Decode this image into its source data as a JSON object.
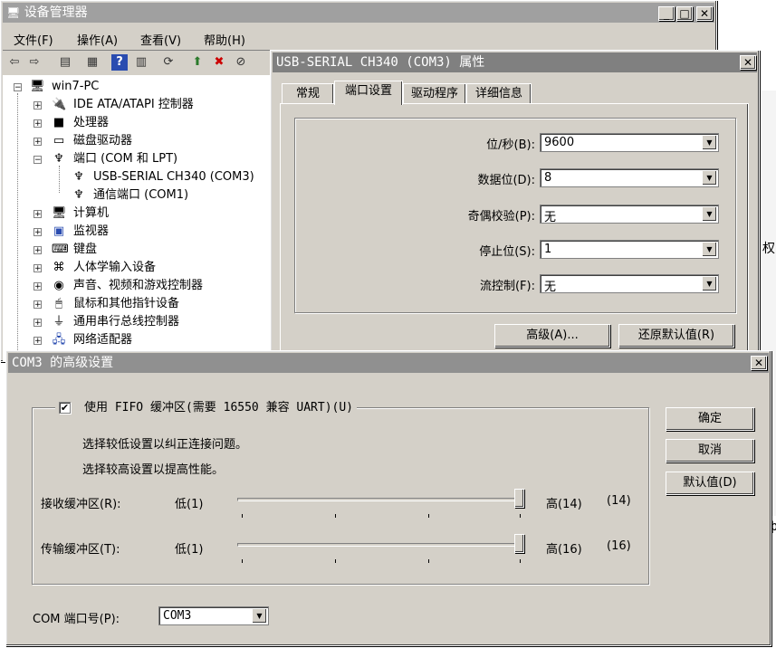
{
  "devmgr": {
    "title": "设备管理器",
    "menu": [
      "文件(F)",
      "操作(A)",
      "查看(V)",
      "帮助(H)"
    ],
    "root": "win7-PC",
    "tree": [
      {
        "label": "IDE ATA/ATAPI 控制器",
        "icon": "ide-controller-icon"
      },
      {
        "label": "处理器",
        "icon": "processor-icon"
      },
      {
        "label": "磁盘驱动器",
        "icon": "disk-drive-icon"
      },
      {
        "label": "端口 (COM 和 LPT)",
        "icon": "port-icon"
      },
      {
        "label": "USB-SERIAL CH340 (COM3)",
        "icon": "port-icon"
      },
      {
        "label": "通信端口 (COM1)",
        "icon": "port-icon"
      },
      {
        "label": "计算机",
        "icon": "computer-icon"
      },
      {
        "label": "监视器",
        "icon": "monitor-icon"
      },
      {
        "label": "键盘",
        "icon": "keyboard-icon"
      },
      {
        "label": "人体学输入设备",
        "icon": "hid-icon"
      },
      {
        "label": "声音、视频和游戏控制器",
        "icon": "sound-icon"
      },
      {
        "label": "鼠标和其他指针设备",
        "icon": "mouse-icon"
      },
      {
        "label": "通用串行总线控制器",
        "icon": "usb-icon"
      },
      {
        "label": "网络适配器",
        "icon": "network-icon"
      }
    ]
  },
  "props": {
    "title": "USB-SERIAL CH340 (COM3) 属性",
    "tabs": [
      "常规",
      "端口设置",
      "驱动程序",
      "详细信息"
    ],
    "active_tab": "端口设置",
    "fields": [
      {
        "label": "位/秒(B):",
        "value": "9600"
      },
      {
        "label": "数据位(D):",
        "value": "8"
      },
      {
        "label": "奇偶校验(P):",
        "value": "无"
      },
      {
        "label": "停止位(S):",
        "value": "1"
      },
      {
        "label": "流控制(F):",
        "value": "无"
      }
    ],
    "advanced_btn": "高级(A)...",
    "restore_btn": "还原默认值(R)"
  },
  "adv": {
    "title": "COM3 的高级设置",
    "fifo_label": "使用 FIFO 缓冲区(需要 16550 兼容 UART)(U)",
    "fifo_checked": true,
    "hint1": "选择较低设置以纠正连接问题。",
    "hint2": "选择较高设置以提高性能。",
    "receive": {
      "label": "接收缓冲区(R):",
      "low": "低(1)",
      "high": "高(14)",
      "value": "(14)",
      "level": 1.0
    },
    "transmit": {
      "label": "传输缓冲区(T):",
      "low": "低(1)",
      "high": "高(16)",
      "value": "(16)",
      "level": 1.0
    },
    "com_label": "COM 端口号(P):",
    "com_value": "COM3",
    "ok": "确定",
    "cancel": "取消",
    "defaults": "默认值(D)"
  },
  "edge_fragments": [
    "权",
    "ф"
  ],
  "colors": {
    "title_inactive": "#808080",
    "face": "#d4d0c8"
  }
}
